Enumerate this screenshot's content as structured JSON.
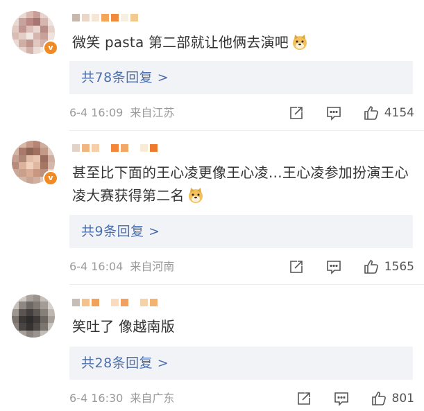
{
  "comments": [
    {
      "content": "微笑 pasta 第二部就让他俩去演吧",
      "emoji": "doge-icon",
      "reply_label": "共78条回复 >",
      "date": "6-4 16:09",
      "location": "来自江苏",
      "likes": "4154",
      "verified": true
    },
    {
      "content": "甚至比下面的王心凌更像王心凌…王心凌参加扮演王心凌大赛获得第二名",
      "emoji": "doge-icon",
      "reply_label": "共9条回复 >",
      "date": "6-4 16:04",
      "location": "来自河南",
      "likes": "1565",
      "verified": true
    },
    {
      "content": "笑吐了 像越南版",
      "emoji": "",
      "reply_label": "共28条回复 >",
      "date": "6-4 16:30",
      "location": "来自广东",
      "likes": "801",
      "verified": false
    }
  ],
  "colors": {
    "reply_link": "#4a6fae",
    "reply_box_bg": "#f2f3f7",
    "meta_text": "#9a9a9a",
    "verified_badge": "#f08a24"
  }
}
